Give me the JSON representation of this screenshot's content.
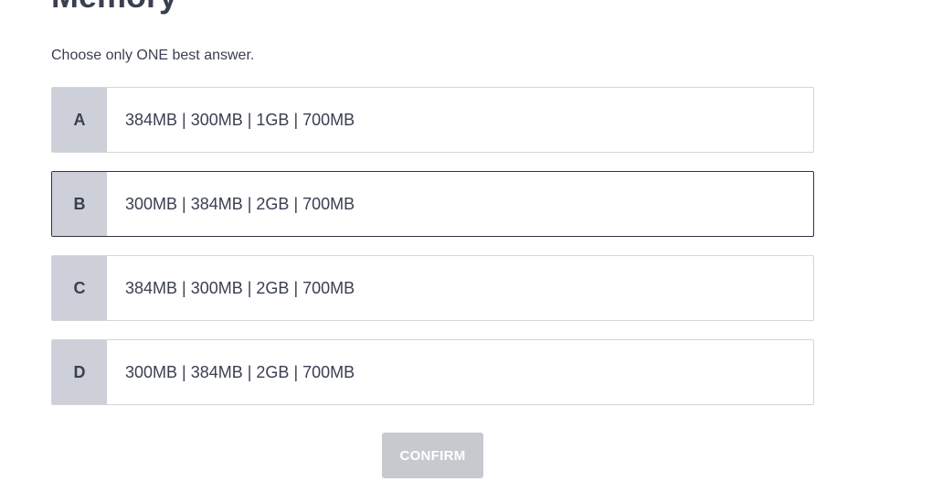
{
  "question": {
    "heading": "Memory",
    "instruction": "Choose only ONE best answer."
  },
  "options": [
    {
      "letter": "A",
      "text": "384MB | 300MB | 1GB | 700MB",
      "selected": false
    },
    {
      "letter": "B",
      "text": "300MB | 384MB | 2GB | 700MB",
      "selected": true
    },
    {
      "letter": "C",
      "text": "384MB | 300MB | 2GB | 700MB",
      "selected": false
    },
    {
      "letter": "D",
      "text": "300MB | 384MB | 2GB | 700MB",
      "selected": false
    }
  ],
  "confirm_button": {
    "label": "CONFIRM",
    "enabled": false
  },
  "colors": {
    "letter_bg": "#cdd0d8",
    "border": "#d3d5da",
    "selected_border": "#2f3542",
    "confirm_disabled_bg": "#c7c9cf"
  }
}
